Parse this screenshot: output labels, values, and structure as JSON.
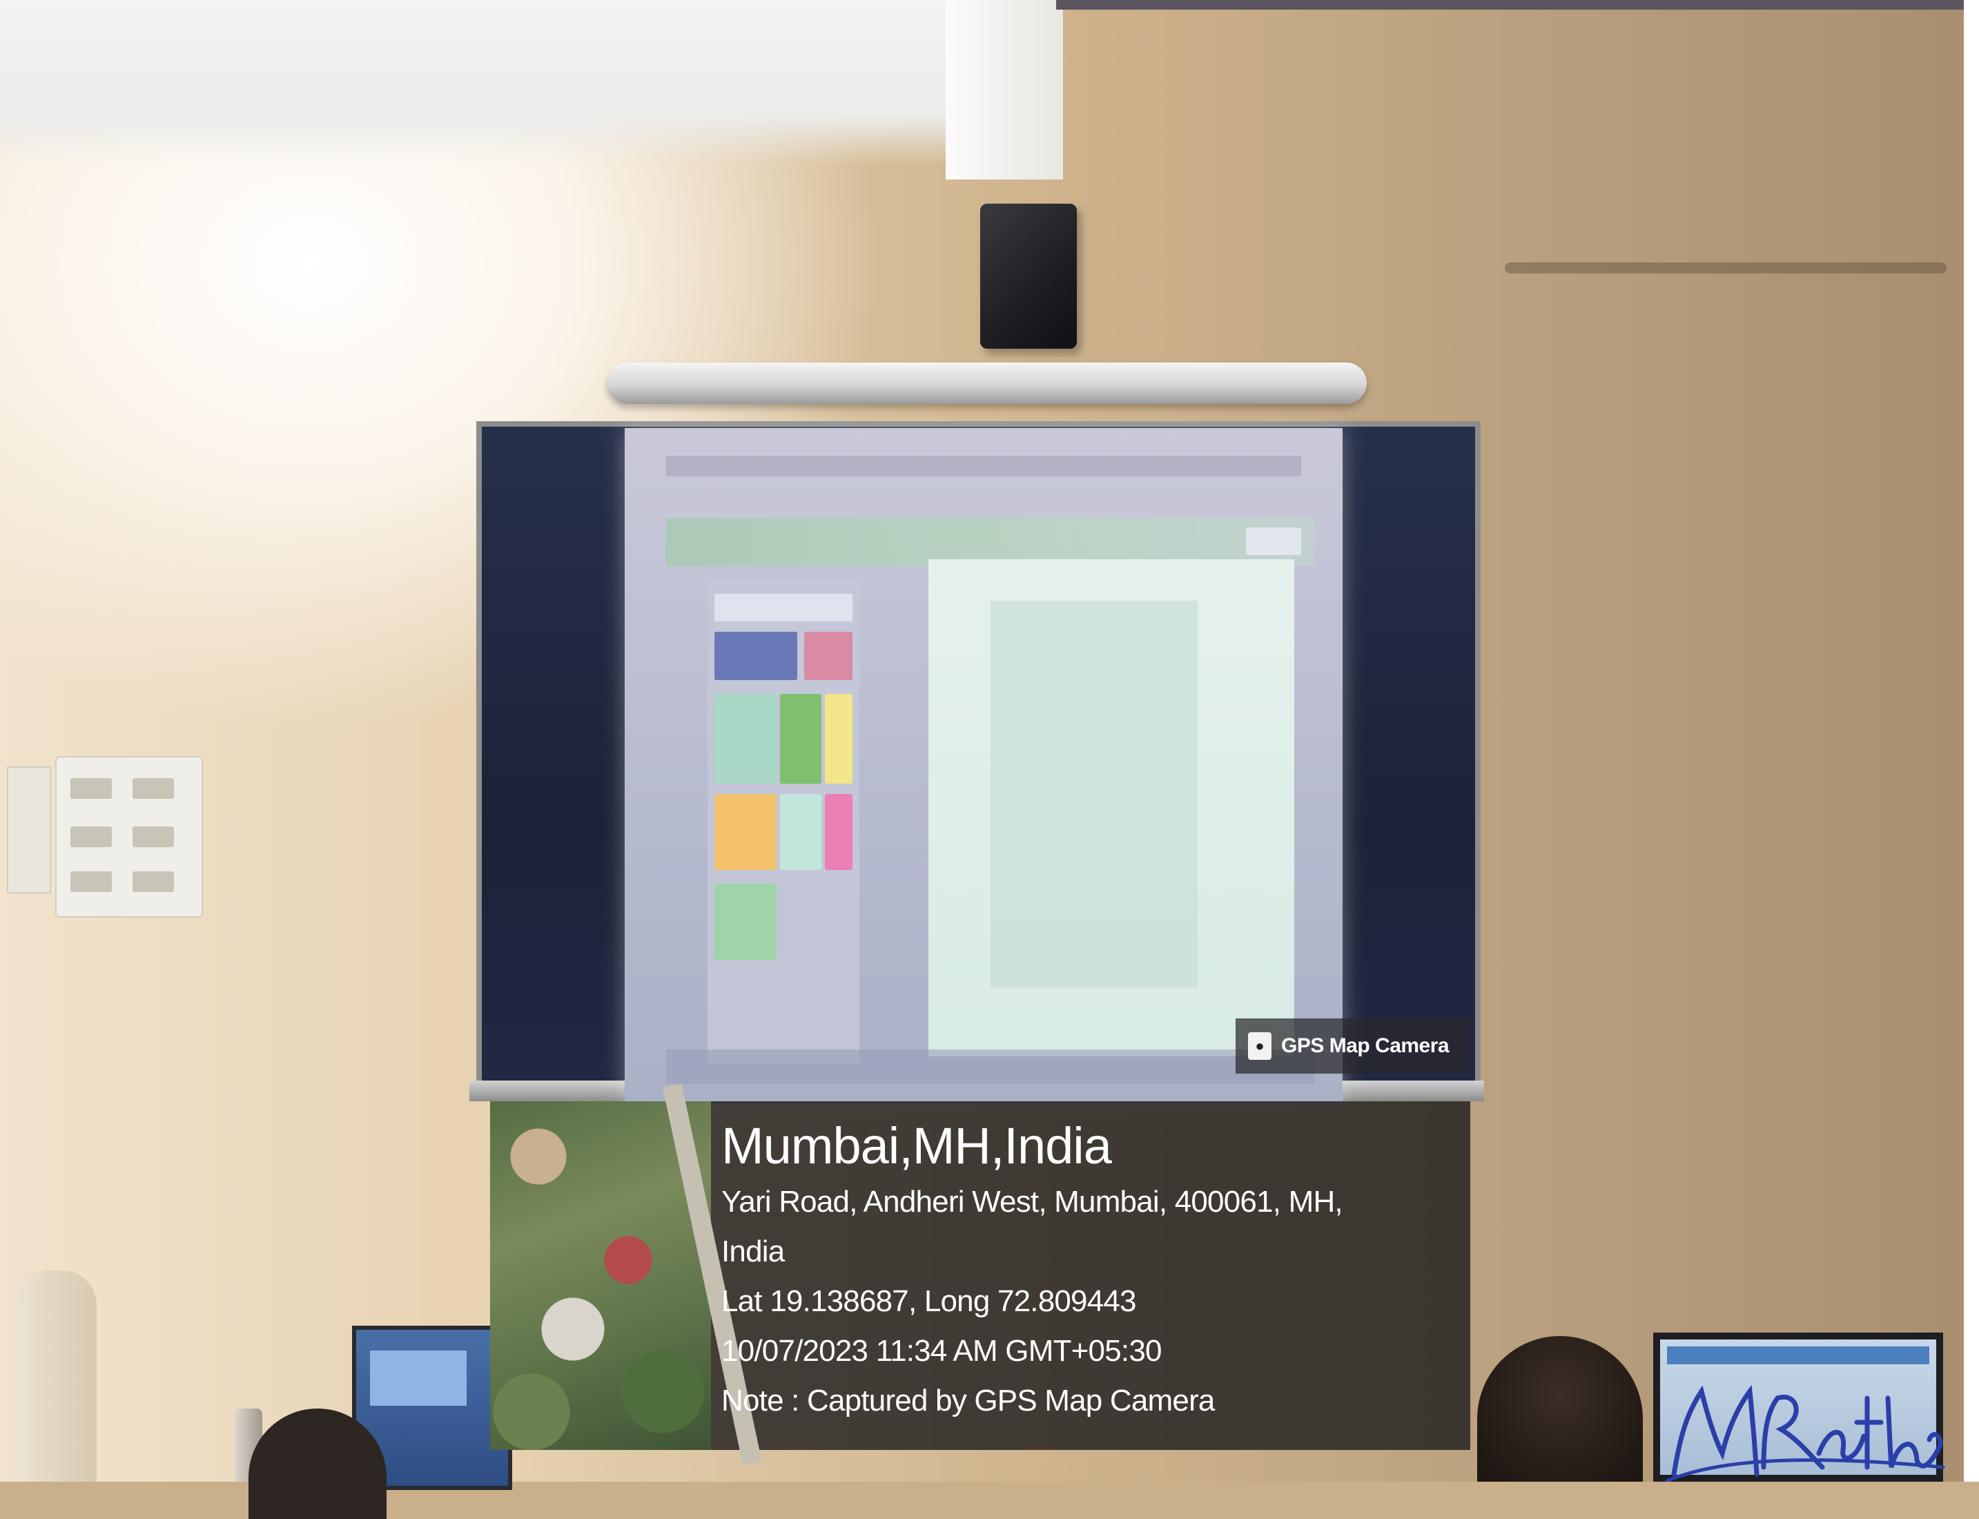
{
  "gps_stamp": {
    "brand_label": "GPS Map Camera",
    "brand_icon": "map-pin-icon",
    "city": "Mumbai,MH,India",
    "address_line1": "Yari Road, Andheri West, Mumbai, 400061, MH,",
    "address_line2": "India",
    "coordinates": "Lat 19.138687, Long 72.809443",
    "datetime": "10/07/2023 11:34 AM GMT+05:30",
    "note": "Note : Captured by GPS Map Camera"
  },
  "scene": {
    "signature": "MRathe"
  },
  "colors": {
    "overlay_bg": "#201e20",
    "overlay_text": "#ffffff",
    "signature_ink": "#2a3fa8",
    "board": "#1c2338",
    "wall": "#cfb48d"
  }
}
